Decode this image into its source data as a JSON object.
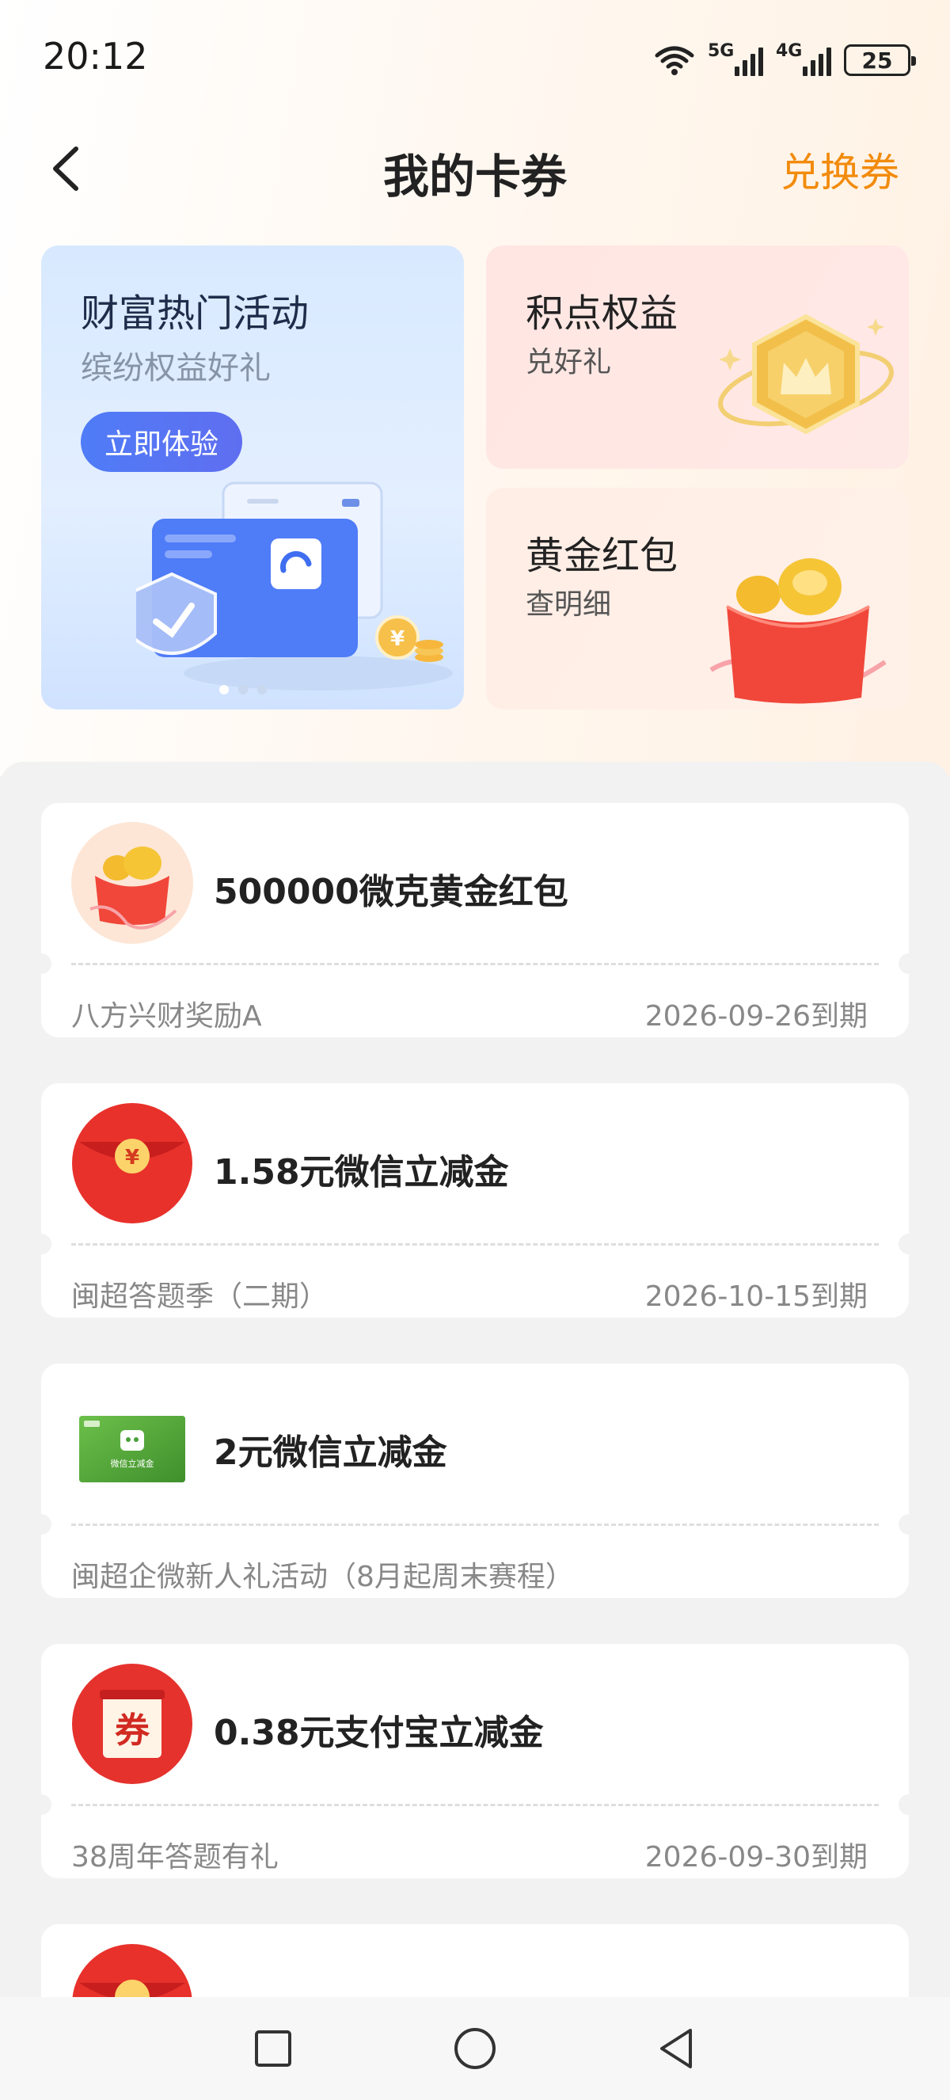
{
  "status_bar": {
    "time": "20:12",
    "signal_1_label": "5G",
    "signal_2_label": "4G",
    "battery": "25"
  },
  "nav": {
    "title": "我的卡券",
    "action": "兑换券"
  },
  "banner": {
    "title": "财富热门活动",
    "subtitle": "缤纷权益好礼",
    "button": "立即体验",
    "page_count": 3,
    "active_page": 1
  },
  "side_cards": [
    {
      "title": "积点权益",
      "subtitle": "兑好礼",
      "icon": "crown-badge-icon"
    },
    {
      "title": "黄金红包",
      "subtitle": "查明细",
      "icon": "gold-red-envelope-icon"
    }
  ],
  "coupons": [
    {
      "name": "500000微克黄金红包",
      "source": "八方兴财奖励A",
      "expiry": "2026-09-26到期",
      "icon": "gold-red-envelope-icon"
    },
    {
      "name": "1.58元微信立减金",
      "source": "闽超答题季（二期）",
      "expiry": "2026-10-15到期",
      "icon": "red-envelope-icon"
    },
    {
      "name": "2元微信立减金",
      "source": "闽超企微新人礼活动（8月起周末赛程）",
      "expiry": "",
      "icon": "wechat-voucher-icon",
      "icon_text": "微信立减金"
    },
    {
      "name": "0.38元支付宝立减金",
      "source": "38周年答题有礼",
      "expiry": "2026-09-30到期",
      "icon": "coupon-stamp-icon",
      "icon_text": "券"
    }
  ],
  "colors": {
    "accent_orange": "#f28b0c",
    "button_blue": "#4f7cf7",
    "page_bg": "#f2f2f2"
  }
}
